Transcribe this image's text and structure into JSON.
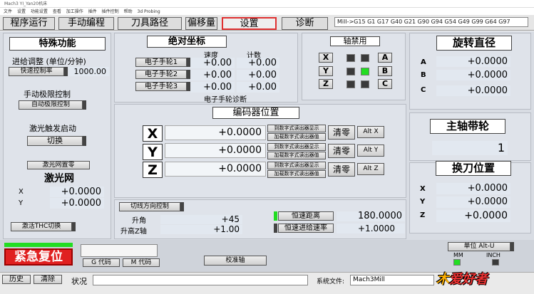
{
  "window": {
    "title": "Mach3 YI_Yan20机床"
  },
  "menu": [
    "文件",
    "设置",
    "功能设置",
    "查看",
    "加工操作",
    "插件",
    "插件控制",
    "帮助",
    "3d Probing"
  ],
  "tabs": [
    "程序运行",
    "手动编程",
    "刀具路径",
    "偏移量",
    "设置",
    "诊断"
  ],
  "active_tab": "设置",
  "gcodes": "Mill->G15  G1 G17 G40 G21 G90 G94 G54 G49 G99 G64 G97",
  "special": {
    "title": "特殊功能",
    "feed_label": "进给调整 (单位/分钟)",
    "fast_btn": "快速控制率",
    "feed_value": "1000.00",
    "jog_label": "手动极限控制",
    "auto_btn": "自动极限控制",
    "laser_label": "激光触发启动",
    "switch_btn": "切换",
    "laser_zero_btn": "激光网置零",
    "laser_net": "激光网",
    "x_label": "X",
    "x_value": "+0.0000",
    "y_label": "Y",
    "y_value": "+0.0000",
    "thc_btn": "激活THC切换"
  },
  "absolute": {
    "title": "绝对坐标",
    "col_speed": "速度",
    "col_count": "计数",
    "rows": [
      {
        "label": "电子手轮1",
        "speed": "+0.00",
        "count": "+0.00"
      },
      {
        "label": "电子手轮2",
        "speed": "+0.00",
        "count": "+0.00"
      },
      {
        "label": "电子手轮3",
        "speed": "+0.00",
        "count": "+0.00"
      }
    ],
    "diag": "电子手轮诊断"
  },
  "axis_lock": {
    "title": "轴禁用",
    "keys": [
      "X",
      "Y",
      "Z"
    ],
    "right_keys": [
      "A",
      "B",
      "C"
    ]
  },
  "rotation": {
    "title": "旋转直径",
    "rows": [
      {
        "label": "A",
        "value": "+0.0000"
      },
      {
        "label": "B",
        "value": "+0.0000"
      },
      {
        "label": "C",
        "value": "+0.0000"
      }
    ]
  },
  "encoder": {
    "title": "编码器位置",
    "axes": [
      {
        "label": "X",
        "value": "+0.0000",
        "btn1": "到数字式读出器显示",
        "btn2": "加载数字式读出器值",
        "zero": "清零",
        "alt": "Alt X"
      },
      {
        "label": "Y",
        "value": "+0.0000",
        "btn1": "到数字式读出器显示",
        "btn2": "加载数字式读出器值",
        "zero": "清零",
        "alt": "Alt Y"
      },
      {
        "label": "Z",
        "value": "+0.0000",
        "btn1": "到数字式读出器显示",
        "btn2": "加载数字式读出器值",
        "zero": "清零",
        "alt": "Alt Z"
      }
    ]
  },
  "spindle": {
    "title": "主轴带轮",
    "value": "1"
  },
  "toolchange": {
    "title": "换刀位置",
    "rows": [
      {
        "label": "X",
        "value": "+0.0000"
      },
      {
        "label": "Y",
        "value": "+0.0000"
      },
      {
        "label": "Z",
        "value": "+0.0000"
      }
    ]
  },
  "cutline": {
    "btn": "切线方向控制",
    "lift_label": "升角",
    "lift_value": "+45",
    "z_label": "升高Z轴",
    "z_value": "+1.00",
    "dist_btn": "恒速距离",
    "dist_value": "180.0000",
    "feed_btn": "恒速进给速率",
    "feed_value": "+1.0000"
  },
  "bottom": {
    "estop": "紧急复位",
    "gcode_btn": "G 代码",
    "mcode_btn": "M 代码",
    "calib_btn": "校准轴",
    "unit_btn": "单位 Alt-U",
    "mm": "MM",
    "inch": "INCH"
  },
  "status": {
    "history": "历史",
    "clear": "清除",
    "status_label": "状况",
    "status_text": "",
    "file_label": "系统文件:",
    "file_value": "Mach3Mill"
  },
  "watermark": "爱好者"
}
